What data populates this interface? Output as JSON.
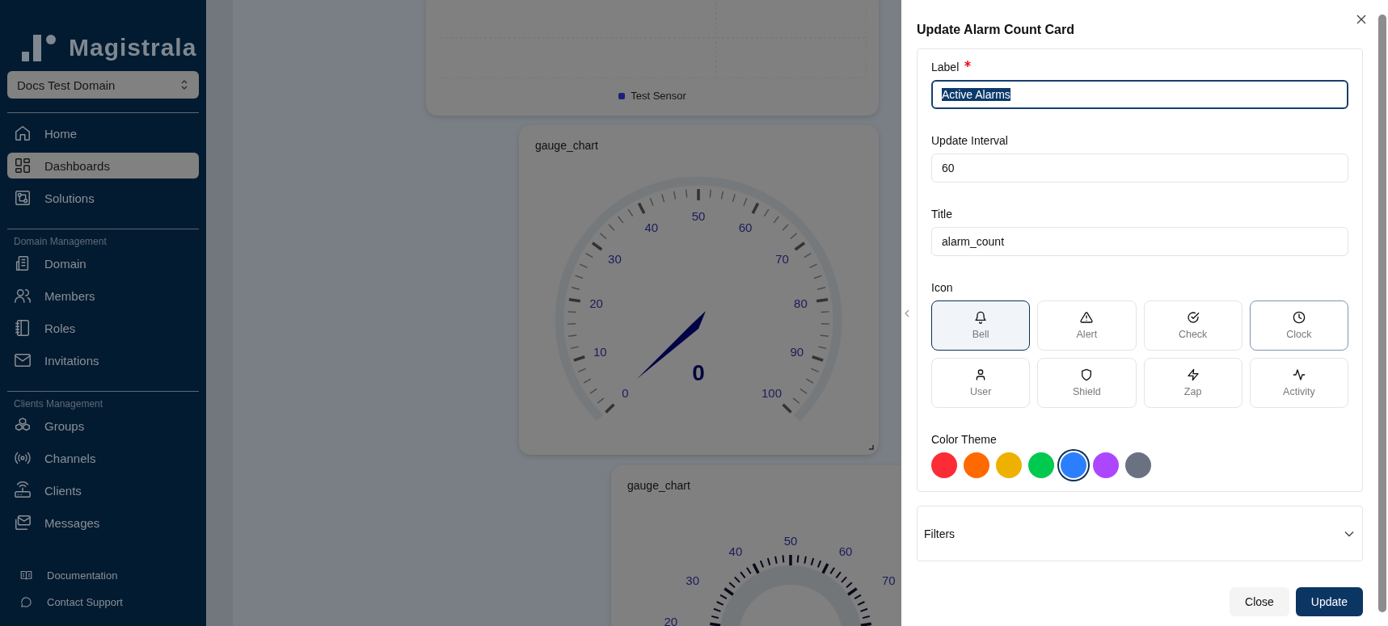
{
  "sidebar": {
    "brand": "Magistrala",
    "domain_select": "Docs Test Domain",
    "sections": [
      {
        "items": [
          {
            "label": "Home",
            "selected": false
          },
          {
            "label": "Dashboards",
            "selected": true
          },
          {
            "label": "Solutions",
            "selected": false
          }
        ]
      },
      {
        "heading": "Domain Management",
        "items": [
          {
            "label": "Domain",
            "selected": false
          },
          {
            "label": "Members",
            "selected": false
          },
          {
            "label": "Roles",
            "selected": false
          },
          {
            "label": "Invitations",
            "selected": false
          }
        ]
      },
      {
        "heading": "Clients Management",
        "items": [
          {
            "label": "Groups",
            "selected": false
          },
          {
            "label": "Channels",
            "selected": false
          },
          {
            "label": "Clients",
            "selected": false
          },
          {
            "label": "Messages",
            "selected": false
          }
        ]
      }
    ],
    "footer_links": [
      "Documentation",
      "Contact Support"
    ]
  },
  "dashboard": {
    "widgets": [
      {
        "kind": "chart",
        "legend": [
          {
            "label": "Test Sensor",
            "color": "#1f1f7a"
          }
        ]
      },
      {
        "kind": "gauge",
        "title": "gauge_chart",
        "scale_labels": [
          "0",
          "10",
          "20",
          "30",
          "40",
          "50",
          "60",
          "70",
          "80",
          "90",
          "100"
        ],
        "value": "0"
      },
      {
        "kind": "gauge_outer",
        "title": "gauge_chart",
        "scale_labels": [
          "20",
          "30",
          "40",
          "50",
          "60",
          "70"
        ]
      }
    ]
  },
  "dialog": {
    "title": "Update Alarm Count Card",
    "fields": [
      {
        "label": "Label",
        "required": true,
        "value": "Active Alarms",
        "focused": true
      },
      {
        "label": "Update Interval",
        "required": false,
        "value": "60",
        "focused": false
      },
      {
        "label": "Title",
        "required": false,
        "value": "alarm_count",
        "focused": false
      }
    ],
    "icon_picker": {
      "label": "Icon",
      "options": [
        {
          "label": "Bell",
          "selected": true,
          "hovered": false
        },
        {
          "label": "Alert",
          "selected": false,
          "hovered": false
        },
        {
          "label": "Check",
          "selected": false,
          "hovered": false
        },
        {
          "label": "Clock",
          "selected": false,
          "hovered": true
        },
        {
          "label": "User",
          "selected": false,
          "hovered": false
        },
        {
          "label": "Shield",
          "selected": false,
          "hovered": false
        },
        {
          "label": "Zap",
          "selected": false,
          "hovered": false
        },
        {
          "label": "Activity",
          "selected": false,
          "hovered": false
        }
      ]
    },
    "color_theme": {
      "label": "Color Theme",
      "swatches": [
        {
          "color": "#fb2c36",
          "selected": false
        },
        {
          "color": "#ff6900",
          "selected": false
        },
        {
          "color": "#efb100",
          "selected": false
        },
        {
          "color": "#00c950",
          "selected": false
        },
        {
          "color": "#2b7fff",
          "selected": true
        },
        {
          "color": "#ad46ff",
          "selected": false
        },
        {
          "color": "#6a7282",
          "selected": false
        }
      ]
    },
    "filters": {
      "label": "Filters",
      "expanded": false
    },
    "buttons": [
      {
        "label": "Close",
        "kind": "secondary"
      },
      {
        "label": "Update",
        "kind": "primary"
      }
    ]
  }
}
